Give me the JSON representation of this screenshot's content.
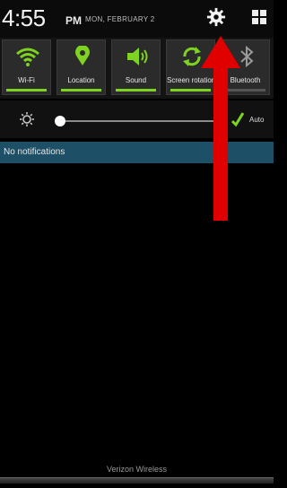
{
  "status_bar": {
    "time": "4:55",
    "ampm": "PM",
    "date": "MON, FEBRUARY 2",
    "settings_icon": "gear-icon",
    "grid_icon": "grid-icon"
  },
  "quick_toggles": [
    {
      "label": "Wi-Fi",
      "icon": "wifi-icon",
      "active": true
    },
    {
      "label": "Location",
      "icon": "location-pin-icon",
      "active": true
    },
    {
      "label": "Sound",
      "icon": "speaker-icon",
      "active": true
    },
    {
      "label": "Screen rotation",
      "icon": "rotate-icon",
      "active": true
    },
    {
      "label": "Bluetooth",
      "icon": "bluetooth-icon",
      "active": false
    }
  ],
  "brightness": {
    "icon": "brightness-icon",
    "level": 0.02,
    "auto_label": "Auto"
  },
  "notifications": {
    "header": "No notifications"
  },
  "carrier": "Verizon Wireless",
  "colors": {
    "accent": "#7ed321",
    "header_bg": "#1d4f66",
    "arrow": "#e00000"
  }
}
